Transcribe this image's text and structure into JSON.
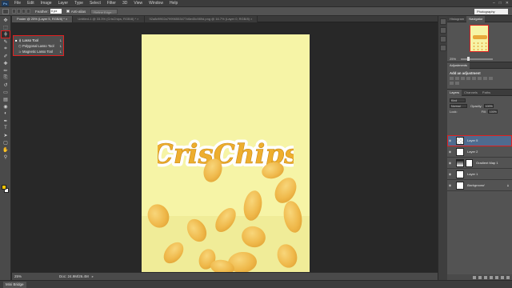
{
  "app": {
    "logo": "Ps",
    "menu": [
      "File",
      "Edit",
      "Image",
      "Layer",
      "Type",
      "Select",
      "Filter",
      "3D",
      "View",
      "Window",
      "Help"
    ],
    "window_controls": [
      "–",
      "□",
      "✕"
    ]
  },
  "options_bar": {
    "feather_label": "Feather:",
    "feather_value": "0 px",
    "antialias_label": "Anti-alias",
    "refine_button": "Refine Edge...",
    "workspace": "Photography"
  },
  "tabs": [
    {
      "label": "Poster @ 25% (Layer 5, RGB/8) *  ×",
      "active": true
    },
    {
      "label": "Untitled-1 @ 33.3% (CrisChips, RGB/8) *  ×",
      "active": false
    },
    {
      "label": "92a8d9902a79996553477d6e45c989d.png @ 16.7% (Layer 0, RGB/8)  ×",
      "active": false
    }
  ],
  "flyout": {
    "items": [
      {
        "label": "Lasso Tool",
        "key": "L",
        "icon": "lasso-icon",
        "selected": true
      },
      {
        "label": "Polygonal Lasso Tool",
        "key": "L",
        "icon": "polygonal-lasso-icon",
        "selected": false
      },
      {
        "label": "Magnetic Lasso Tool",
        "key": "L",
        "icon": "magnetic-lasso-icon",
        "selected": false
      }
    ]
  },
  "toolbox": {
    "tools": [
      "move",
      "marquee",
      "lasso",
      "quick-select",
      "crop",
      "eyedropper",
      "healing",
      "brush",
      "clone-stamp",
      "history-brush",
      "eraser",
      "gradient",
      "blur",
      "dodge",
      "pen",
      "type",
      "path-select",
      "shape",
      "hand",
      "zoom"
    ],
    "glyphs": [
      "✥",
      "⬚",
      "ϕ",
      "✎",
      "⌗",
      "✐",
      "✚",
      "✏",
      "⎘",
      "↺",
      "▭",
      "▤",
      "◉",
      "◐",
      "✒",
      "T",
      "➤",
      "▢",
      "✋",
      "⚲"
    ],
    "foreground_color": "#f5c400",
    "background_color": "#ffffff"
  },
  "canvas": {
    "logo_text": "CrisChips",
    "doc_bg": "#f6f4a6"
  },
  "status_bar": {
    "zoom": "25%",
    "doc_info": "Doc: 24.9M/26.4M"
  },
  "mini_bridge": {
    "label": "Mini Bridge"
  },
  "navigator": {
    "tabs": [
      "Histogram",
      "Navigator"
    ],
    "zoom": "25%"
  },
  "adjustments": {
    "tab": "Adjustments",
    "subtitle": "Add an adjustment"
  },
  "layers_panel": {
    "tabs": [
      "Layers",
      "Channels",
      "Paths"
    ],
    "kind": "Kind",
    "blend_mode": "Normal",
    "opacity_label": "Opacity:",
    "opacity_value": "100%",
    "lock_label": "Lock:",
    "fill_label": "Fill:",
    "fill_value": "100%",
    "layers": [
      {
        "name": "Layer 5",
        "selected": true,
        "thumb": "checker",
        "visible": true
      },
      {
        "name": "Layer 2",
        "selected": false,
        "thumb": "white",
        "visible": true
      },
      {
        "name": "Gradient Map 1",
        "selected": false,
        "thumb": "adjustment",
        "visible": true
      },
      {
        "name": "Layer 1",
        "selected": false,
        "thumb": "white",
        "visible": true
      },
      {
        "name": "Background",
        "selected": false,
        "thumb": "white",
        "visible": true,
        "locked": true
      }
    ]
  }
}
